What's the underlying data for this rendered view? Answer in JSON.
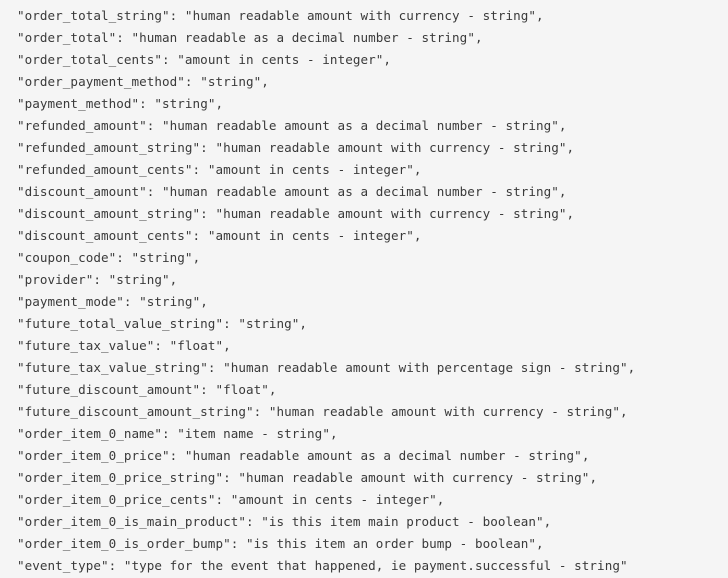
{
  "code": {
    "lines": [
      {
        "key": "order_total_string",
        "value": "human readable amount with currency - string",
        "trail": ","
      },
      {
        "key": "order_total",
        "value": "human readable as a decimal number - string",
        "trail": ","
      },
      {
        "key": "order_total_cents",
        "value": "amount in cents - integer",
        "trail": ","
      },
      {
        "key": "order_payment_method",
        "value": "string",
        "trail": ","
      },
      {
        "key": "payment_method",
        "value": "string",
        "trail": ","
      },
      {
        "key": "refunded_amount",
        "value": "human readable amount as a decimal number - string",
        "trail": ","
      },
      {
        "key": "refunded_amount_string",
        "value": "human readable amount with currency - string",
        "trail": ","
      },
      {
        "key": "refunded_amount_cents",
        "value": "amount in cents - integer",
        "trail": ","
      },
      {
        "key": "discount_amount",
        "value": "human readable amount as a decimal number - string",
        "trail": ","
      },
      {
        "key": "discount_amount_string",
        "value": "human readable amount with currency - string",
        "trail": ","
      },
      {
        "key": "discount_amount_cents",
        "value": "amount in cents - integer",
        "trail": ","
      },
      {
        "key": "coupon_code",
        "value": "string",
        "trail": ","
      },
      {
        "key": "provider",
        "value": "string",
        "trail": ","
      },
      {
        "key": "payment_mode",
        "value": "string",
        "trail": ","
      },
      {
        "key": "future_total_value_string",
        "value": "string",
        "trail": ","
      },
      {
        "key": "future_tax_value",
        "value": "float",
        "trail": ","
      },
      {
        "key": "future_tax_value_string",
        "value": "human readable amount with percentage sign - string",
        "trail": ","
      },
      {
        "key": "future_discount_amount",
        "value": "float",
        "trail": ","
      },
      {
        "key": "future_discount_amount_string",
        "value": "human readable amount with currency - string",
        "trail": ","
      },
      {
        "key": "order_item_0_name",
        "value": "item name - string",
        "trail": ","
      },
      {
        "key": "order_item_0_price",
        "value": "human readable amount as a decimal number - string",
        "trail": ","
      },
      {
        "key": "order_item_0_price_string",
        "value": "human readable amount with currency - string",
        "trail": ","
      },
      {
        "key": "order_item_0_price_cents",
        "value": "amount in cents - integer",
        "trail": ","
      },
      {
        "key": "order_item_0_is_main_product",
        "value": "is this item main product - boolean",
        "trail": ","
      },
      {
        "key": "order_item_0_is_order_bump",
        "value": "is this item an order bump - boolean",
        "trail": ","
      },
      {
        "key": "event_type",
        "value": "type for the event that happened, ie payment.successful - string",
        "trail": ""
      }
    ]
  }
}
